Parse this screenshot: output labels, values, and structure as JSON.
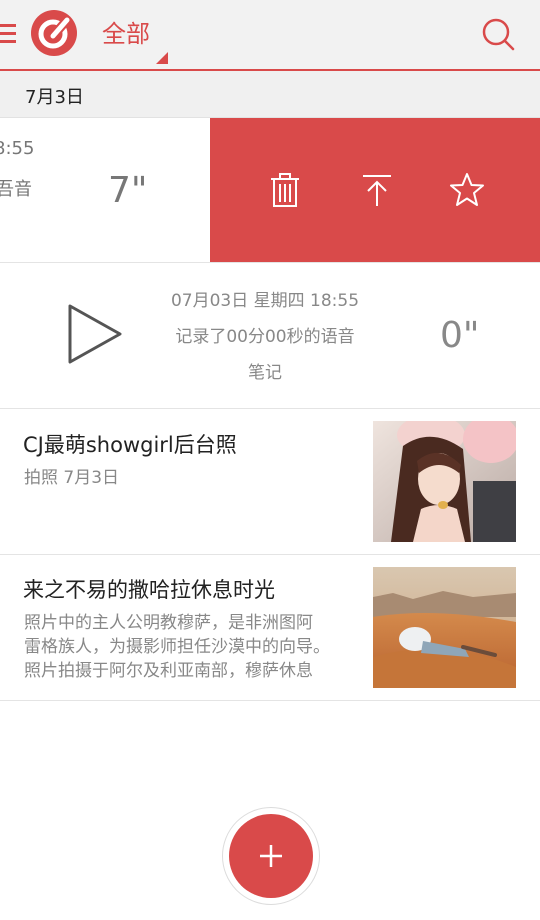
{
  "header": {
    "filter_label": "全部",
    "icons": [
      "menu-icon",
      "app-logo-icon",
      "search-icon"
    ],
    "accent_color": "#d94a4a"
  },
  "date_group": {
    "label": "7月3日"
  },
  "swiped_item": {
    "time_partial": "8:55",
    "desc_partial": "吾音",
    "duration": "7\"",
    "actions": [
      {
        "icon": "trash-icon",
        "name": "delete"
      },
      {
        "icon": "pin-top-icon",
        "name": "pin-to-top"
      },
      {
        "icon": "star-icon",
        "name": "favorite"
      }
    ]
  },
  "voice_note": {
    "datetime": "07月03日  星期四 18:55",
    "desc_line1": "记录了00分00秒的语音",
    "desc_line2": "笔记",
    "duration": "0\""
  },
  "notes": [
    {
      "title": "CJ最萌showgirl后台照",
      "subtitle": "拍照 7月3日"
    },
    {
      "title": "来之不易的撒哈拉休息时光",
      "excerpt_lines": [
        "照片中的主人公明教穆萨，是非洲图阿",
        "雷格族人，为摄影师担任沙漠中的向导。",
        "照片拍摄于阿尔及利亚南部，穆萨休息"
      ]
    }
  ],
  "fab": {
    "icon": "plus-icon"
  }
}
